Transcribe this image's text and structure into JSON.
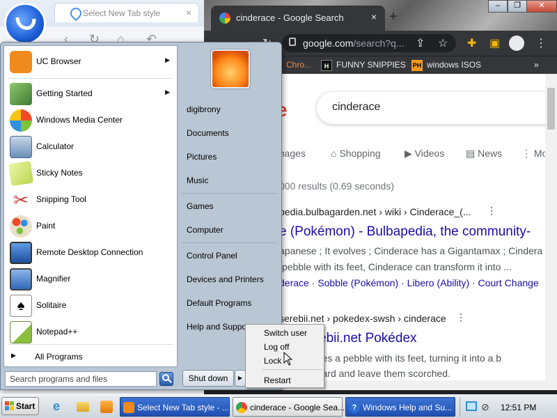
{
  "uc_browser": {
    "tab_title": "Select New Tab style",
    "tab_close": "×"
  },
  "chrome": {
    "tab_title": "cinderace - Google Search",
    "tab_close": "×",
    "new_tab": "+",
    "url_host": "google.com",
    "url_rest": "/search?q...",
    "bookmarks": [
      {
        "label": "Chro..."
      },
      {
        "label": "FUNNY SNIPPIES",
        "badge": "H"
      },
      {
        "label": "windows ISOS",
        "badge": "PH"
      }
    ],
    "bookmarks_more": "»",
    "page": {
      "logo_fragment": "e",
      "query": "cinderace",
      "tabs": [
        "Images",
        "Shopping",
        "Videos",
        "News",
        "Mo"
      ],
      "result_stats": "000 results (0.69 seconds)",
      "results": [
        {
          "cite": "pedia.bulbagarden.net › wiki › Cinderace_(...",
          "title": "e (Pokémon) - Bulbapedia, the community-",
          "snippet_1": "apanese ; It evolves ; Cinderace has a Gigantamax ; Cindera",
          "snippet_2": "pebble with its feet, Cinderace can transform it into ...",
          "links": "derace · Sobble (Pokémon) · Libero (Ability) · Court Change"
        },
        {
          "cite": "serebii.net › pokedex-swsh › cinderace",
          "title": "5 - Serebii.net Pokédex",
          "snippet_1": "rd, It juggles a pebble with its feet, turning it into a b",
          "snippet_2": "ponents hard and leave them scorched."
        }
      ]
    }
  },
  "start_menu": {
    "programs": [
      {
        "label": "UC Browser",
        "submenu": true,
        "icon": "uc-browser-icon",
        "color": "#f08a1c"
      },
      {
        "label": "Getting Started",
        "submenu": true,
        "icon": "getting-started-icon",
        "color": "#4a8f3c"
      },
      {
        "label": "Windows Media Center",
        "submenu": false,
        "icon": "media-center-icon",
        "color": "#2f9a3a"
      },
      {
        "label": "Calculator",
        "submenu": false,
        "icon": "calculator-icon",
        "color": "#6a8fb8"
      },
      {
        "label": "Sticky Notes",
        "submenu": false,
        "icon": "sticky-notes-icon",
        "color": "#c8e06a"
      },
      {
        "label": "Snipping Tool",
        "submenu": false,
        "icon": "scissors-icon",
        "color": "#c23b3b"
      },
      {
        "label": "Paint",
        "submenu": false,
        "icon": "paint-icon",
        "color": "#4fa3e0"
      },
      {
        "label": "Remote Desktop Connection",
        "submenu": false,
        "icon": "remote-desktop-icon",
        "color": "#2c6fc2"
      },
      {
        "label": "Magnifier",
        "submenu": false,
        "icon": "magnifier-icon",
        "color": "#3a78c8"
      },
      {
        "label": "Solitaire",
        "submenu": false,
        "icon": "solitaire-icon",
        "color": "#e9e9e9"
      },
      {
        "label": "Notepad++",
        "submenu": false,
        "icon": "notepadpp-icon",
        "color": "#8cbf3f"
      }
    ],
    "all_programs": "All Programs",
    "search_placeholder": "Search programs and files",
    "places_group_1": [
      "digibrony",
      "Documents",
      "Pictures",
      "Music"
    ],
    "places_group_2": [
      "Games",
      "Computer"
    ],
    "places_group_3": [
      "Control Panel",
      "Devices and Printers",
      "Default Programs",
      "Help and Support"
    ],
    "shutdown_label": "Shut down",
    "power_options": [
      "Switch user",
      "Log off",
      "Lock"
    ],
    "power_restart": "Restart"
  },
  "taskbar": {
    "start_label": "Start",
    "tasks": [
      {
        "label": "Select New Tab style - ...",
        "active": true
      },
      {
        "label": "cinderace - Google Sea...",
        "active": false
      },
      {
        "label": "Windows Help and Su...",
        "active": true
      }
    ],
    "clock": "12:51 PM"
  }
}
